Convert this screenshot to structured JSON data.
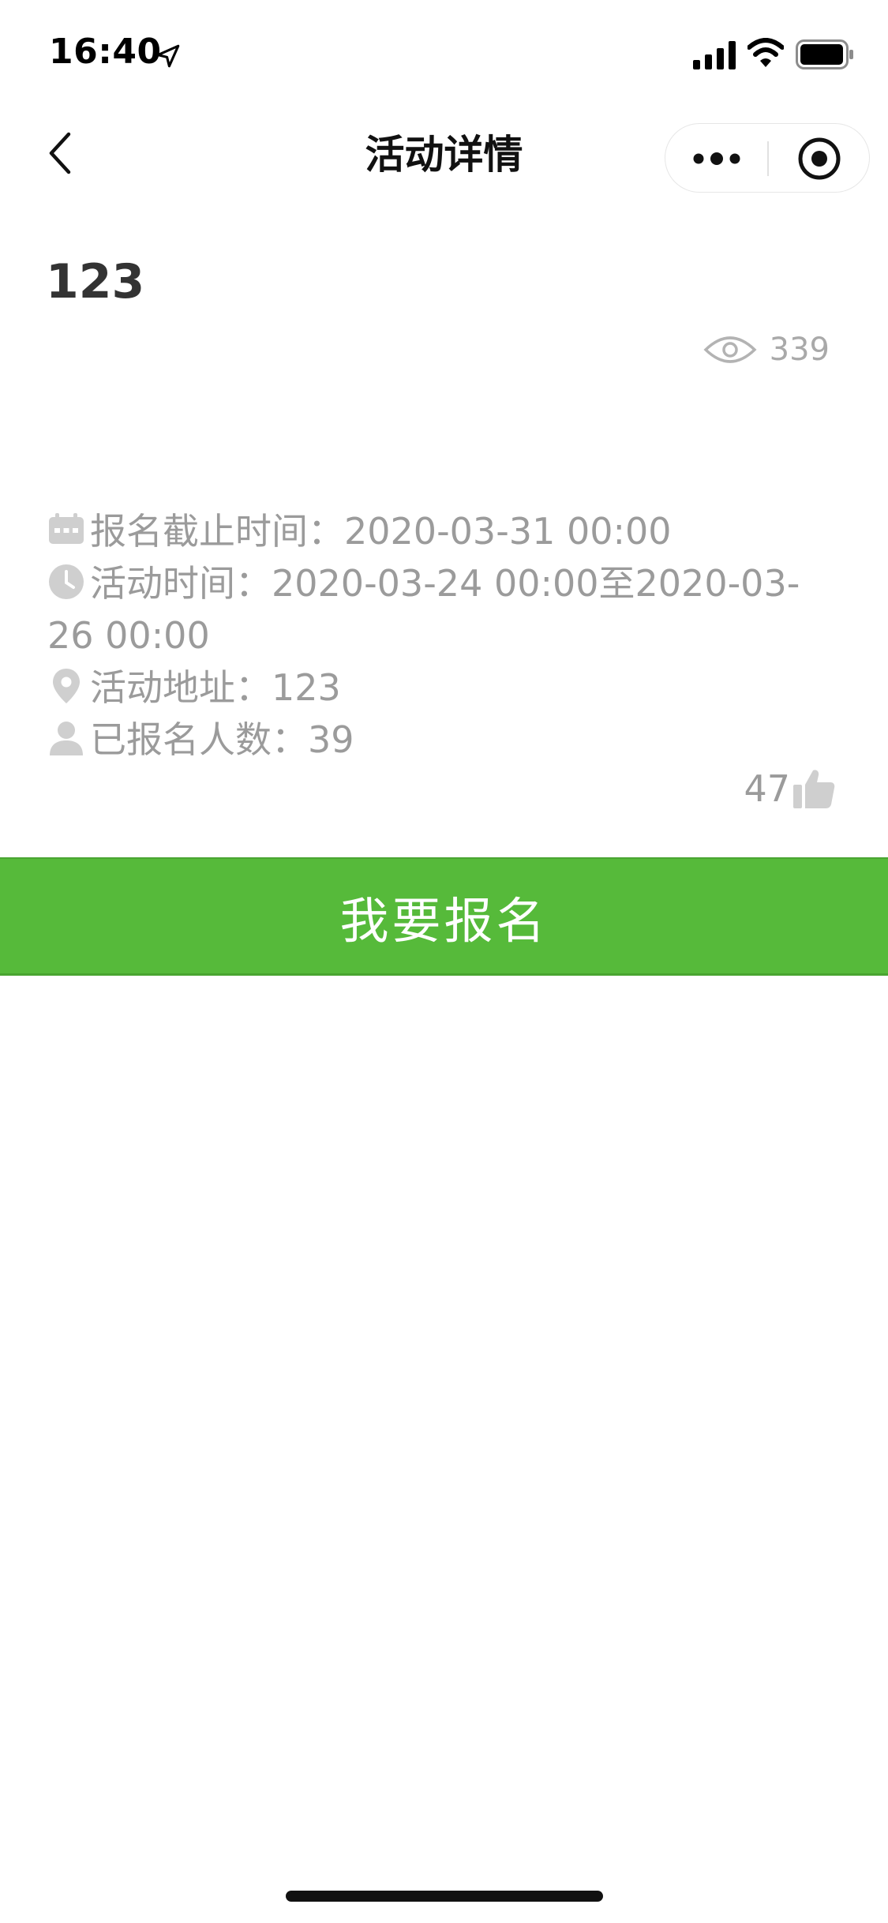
{
  "status_bar": {
    "time": "16:40"
  },
  "nav": {
    "title": "活动详情"
  },
  "activity": {
    "title": "123",
    "views": "339",
    "likes": "47"
  },
  "info": {
    "deadline_label": "报名截止时间：",
    "deadline_value": "2020-03-31 00:00",
    "time_label": "活动时间：",
    "time_value": "2020-03-24 00:00至2020-03-26 00:00",
    "address_label": "活动地址：",
    "address_value": "123",
    "count_label": "已报名人数：",
    "count_value": "39"
  },
  "actions": {
    "signup_label": "我要报名"
  },
  "colors": {
    "accent": "#56ba3a",
    "muted_text": "#9b9b9b",
    "icon_gray": "#cfcfcf"
  }
}
